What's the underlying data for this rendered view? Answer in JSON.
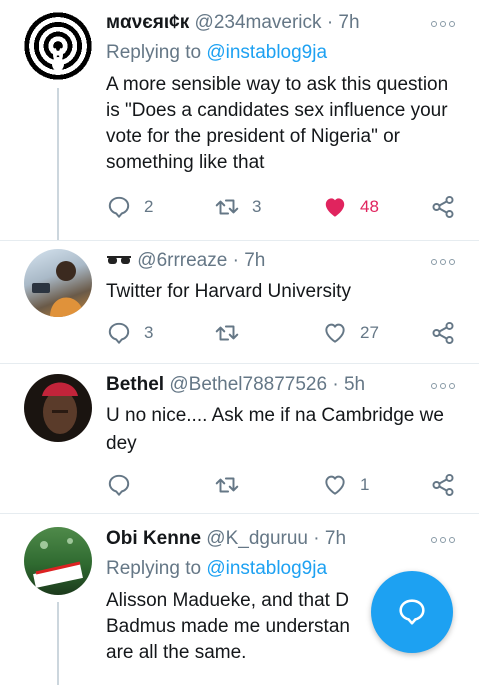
{
  "tweets": [
    {
      "name": "мανєяι¢к",
      "handle": "@234maverick",
      "sep": "·",
      "time": "7h",
      "replying_prefix": "Replying to",
      "replying_to": "@instablog9ja",
      "text": "A more sensible way to ask this question is \"Does a candidates sex influence your vote for the president of Nigeria\" or something like that",
      "replies": "2",
      "retweets": "3",
      "likes": "48",
      "liked": true
    },
    {
      "name_icon": "sunglasses-emoji",
      "handle": "@6rrreaze",
      "sep": "·",
      "time": "7h",
      "text": "Twitter for Harvard University",
      "replies": "3",
      "retweets": "",
      "likes": "27"
    },
    {
      "name": "Bethel",
      "handle": "@Bethel78877526",
      "sep": "·",
      "time": "5h",
      "text": "U no nice.... Ask me if na Cambridge we dey",
      "replies": "",
      "retweets": "",
      "likes": "1"
    },
    {
      "name": "Obi Kenne",
      "handle": "@K_dguruu",
      "sep": "·",
      "time": "7h",
      "replying_prefix": "Replying to",
      "replying_to": "@instablog9ja",
      "text_lines": [
        "Alisson Madueke, and that D",
        "Badmus made me understan",
        "are all the same."
      ]
    }
  ],
  "colors": {
    "accent": "#1da1f2",
    "like": "#e0245e",
    "muted": "#657786",
    "divider": "#e6ecf0"
  },
  "icons": [
    "reply-icon",
    "retweet-icon",
    "heart-icon",
    "share-icon",
    "more-icon",
    "compose-icon"
  ]
}
